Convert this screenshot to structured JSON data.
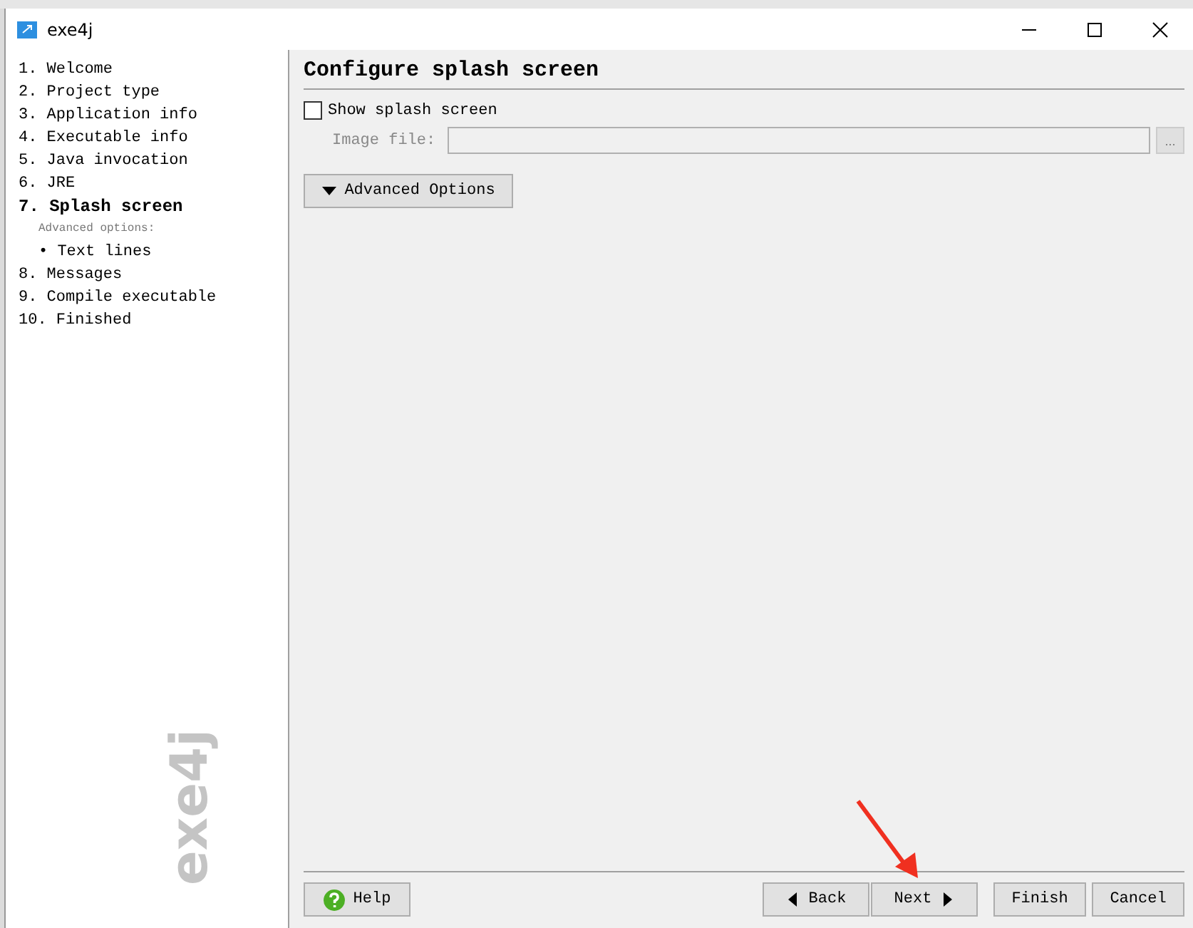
{
  "window": {
    "title": "exe4j"
  },
  "sidebar": {
    "items": [
      {
        "label": "1. Welcome",
        "selected": false
      },
      {
        "label": "2. Project type",
        "selected": false
      },
      {
        "label": "3. Application info",
        "selected": false
      },
      {
        "label": "4. Executable info",
        "selected": false
      },
      {
        "label": "5. Java invocation",
        "selected": false
      },
      {
        "label": "6. JRE",
        "selected": false
      },
      {
        "label": "7. Splash screen",
        "selected": true,
        "children": [
          {
            "kind": "heading",
            "label": "Advanced options:"
          },
          {
            "kind": "link",
            "label": "• Text lines"
          }
        ]
      },
      {
        "label": "8. Messages",
        "selected": false
      },
      {
        "label": "9. Compile executable",
        "selected": false
      },
      {
        "label": "10. Finished",
        "selected": false
      }
    ],
    "logo": "exe4j"
  },
  "page": {
    "title": "Configure splash screen",
    "show_splash": {
      "label": "Show splash screen",
      "checked": false
    },
    "image_file": {
      "label": "Image file:",
      "disabled": true,
      "browse": "..."
    },
    "advanced_button": {
      "label": "Advanced Options",
      "expanded": false
    }
  },
  "buttons": [
    {
      "kind": "help",
      "label": "Help"
    },
    {
      "kind": "back",
      "label": "Back"
    },
    {
      "kind": "next",
      "label": "Next"
    },
    {
      "kind": "plain",
      "label": "Finish"
    },
    {
      "kind": "plain",
      "label": "Cancel"
    }
  ]
}
